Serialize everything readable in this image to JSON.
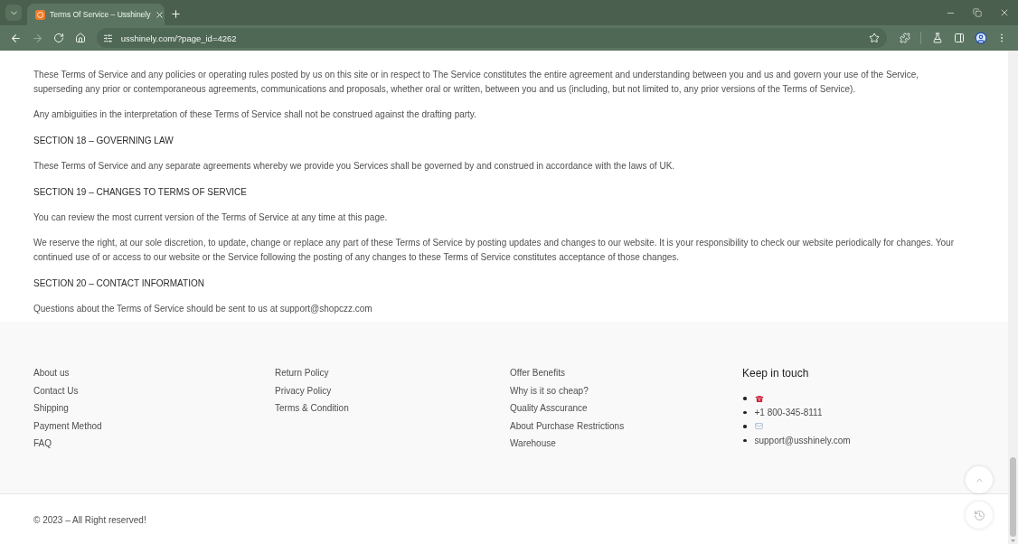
{
  "browser": {
    "tab": {
      "title": "Terms Of Service – Usshinely",
      "selected": true
    },
    "forward_disabled": true,
    "url": "usshinely.com/?page_id=4262"
  },
  "article": {
    "blocks": [
      {
        "kind": "paragraph",
        "text": "These Terms of Service and any policies or operating rules posted by us on this site or in respect to The Service constitutes the entire agreement and understanding between you and us and govern your use of the Service, superseding any prior or contemporaneous agreements, communications and proposals, whether oral or written, between you and us (including, but not limited to, any prior versions of the Terms of Service)."
      },
      {
        "kind": "paragraph",
        "text": "Any ambiguities in the interpretation of these Terms of Service shall not be construed against the drafting party."
      },
      {
        "kind": "heading",
        "text": "SECTION 18 – GOVERNING LAW"
      },
      {
        "kind": "paragraph",
        "text": "These Terms of Service and any separate agreements whereby we provide you Services shall be governed by and construed in accordance with the laws of UK."
      },
      {
        "kind": "heading",
        "text": "SECTION 19 – CHANGES TO TERMS OF SERVICE"
      },
      {
        "kind": "paragraph",
        "text": "You can review the most current version of the Terms of Service at any time at this page."
      },
      {
        "kind": "paragraph",
        "text": "We reserve the right, at our sole discretion, to update, change or replace any part of these Terms of Service by posting updates and changes to our website. It is your responsibility to check our website periodically for changes. Your continued use of or access to our website or the Service following the posting of any changes to these Terms of Service constitutes acceptance of those changes."
      },
      {
        "kind": "heading",
        "text": "SECTION 20 – CONTACT INFORMATION"
      },
      {
        "kind": "paragraph",
        "text": "Questions about the Terms of Service should be sent to us at support@shopczz.com"
      }
    ]
  },
  "footer": {
    "link_columns": [
      [
        "About us",
        "Contact Us",
        "Shipping",
        "Payment Method",
        "FAQ"
      ],
      [
        "Return Policy",
        "Privacy Policy",
        "Terms & Condition"
      ],
      [
        "Offer Benefits",
        "Why is it so cheap?",
        "Quality Asscurance",
        "About Purchase Restrictions",
        "Warehouse"
      ]
    ],
    "contact": {
      "title": "Keep in touch",
      "items": [
        {
          "kind": "phone",
          "text": "+1 800-345-8111"
        },
        {
          "kind": "email",
          "text": "support@usshinely.com"
        }
      ]
    }
  },
  "copyright": "© 2023 – All Right reserved!"
}
